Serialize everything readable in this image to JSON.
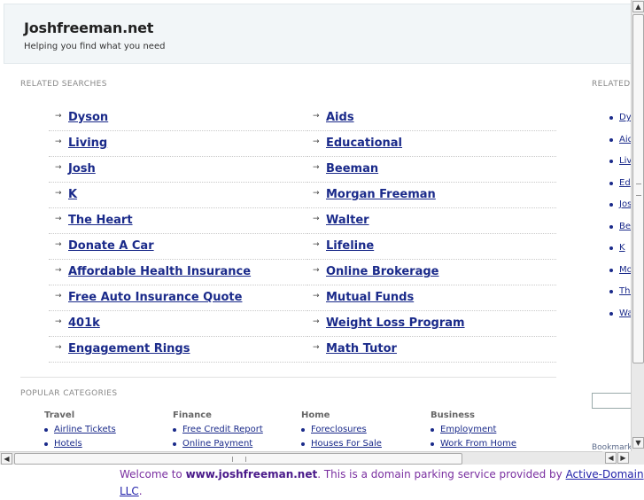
{
  "header": {
    "title": "Joshfreeman.net",
    "tagline": "Helping you find what you need"
  },
  "related": {
    "label": "RELATED SEARCHES",
    "left": [
      "Dyson",
      "Living",
      "Josh",
      "K",
      "The Heart",
      "Donate A Car",
      "Affordable Health Insurance",
      "Free Auto Insurance Quote",
      "401k",
      "Engagement Rings"
    ],
    "right": [
      "Aids",
      "Educational",
      "Beeman",
      "Morgan Freeman",
      "Walter",
      "Lifeline",
      "Online Brokerage",
      "Mutual Funds",
      "Weight Loss Program",
      "Math Tutor"
    ]
  },
  "sidebar": {
    "label": "RELATED",
    "items": [
      "Dys",
      "Aid",
      "Liv",
      "Ed",
      "Jos",
      "Be",
      "K",
      "Mo",
      "The",
      "Wa"
    ],
    "bookmark": "Bookmark"
  },
  "popular": {
    "label": "POPULAR CATEGORIES",
    "categories": [
      {
        "title": "Travel",
        "links": [
          "Airline Tickets",
          "Hotels"
        ]
      },
      {
        "title": "Finance",
        "links": [
          "Free Credit Report",
          "Online Payment"
        ]
      },
      {
        "title": "Home",
        "links": [
          "Foreclosures",
          "Houses For Sale"
        ]
      },
      {
        "title": "Business",
        "links": [
          "Employment",
          "Work From Home"
        ]
      }
    ]
  },
  "footer": {
    "prefix": "Welcome to ",
    "domain": "www.joshfreeman.net",
    "middle": ". This is a domain parking service provided by ",
    "provider": "Active-Domain LLC",
    "suffix": "."
  },
  "icons": {
    "arrow": "→",
    "scroll_up": "▲",
    "scroll_down": "▼",
    "scroll_left": "◀",
    "scroll_right": "▶"
  },
  "colors": {
    "link": "#1a2a8a",
    "header_bg": "#f2f6f8",
    "footer_text": "#7a2fa0"
  }
}
